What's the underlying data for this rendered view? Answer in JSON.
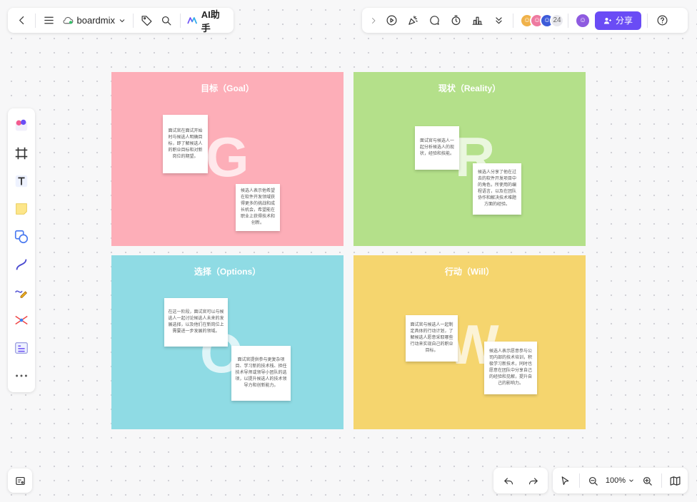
{
  "app": {
    "brand_name": "boardmix",
    "ai_label": "AI助手",
    "collaborator_count": "24",
    "share_label": "分享",
    "zoom_level": "100%"
  },
  "icons": {
    "back": "chevron-left-icon",
    "menu": "hamburger-menu-icon",
    "cloud": "cloud-icon",
    "tag": "tag-icon",
    "search": "search-icon",
    "ai": "ai-logo-icon",
    "play": "play-icon",
    "celebrate": "party-popper-icon",
    "comment": "comment-icon",
    "timer": "timer-icon",
    "vote": "podium-icon",
    "more": "chevron-double-down-icon",
    "help": "help-icon"
  },
  "colors": {
    "goal": "#fdaeb8",
    "reality": "#b4e08a",
    "options": "#8fdbe4",
    "will": "#f5d56e",
    "accent": "#6a4cf5"
  },
  "board": {
    "quadrants": [
      {
        "title": "目标（Goal）",
        "letter": "G",
        "notes": [
          "面试官在面试开始时与候选人明确目标，即了解候选人的职业目标和对新岗位的期望。",
          "候选人表示他希望在软件开发领域获得更多的挑战和成长机会，希望能在职业上获得技术和创新。"
        ]
      },
      {
        "title": "现状（Reality）",
        "letter": "R",
        "notes": [
          "面试官与候选人一起分析候选人的现状，经验和技能。",
          "候选人分享了他在过去的软件开发项目中的角色，所使用的编程语言，以及在团队协作和解决技术难题方面的经验。"
        ]
      },
      {
        "title": "选择（Options）",
        "letter": "O",
        "notes": [
          "在这一阶段，面试官可以与候选人一起讨论候选人未来的发展选择，以及他们在新岗位上需要进一步发展的领域。",
          "面试官提供参与更复杂项目、学习新的技术栈、担任技术导师或领导小团队的选项，以提升候选人的技术领导力和创新能力。"
        ]
      },
      {
        "title": "行动（Will）",
        "letter": "W",
        "notes": [
          "面试官与候选人一起制定具体的行动计划，了解候选人愿意采取哪些行动来实现自己的职业目标。",
          "候选人表示愿意参与公司内部的技术培训，积极学习新技术，同时也愿意在团队中分享自己的经验和见解，提升自己的影响力。"
        ]
      }
    ]
  }
}
